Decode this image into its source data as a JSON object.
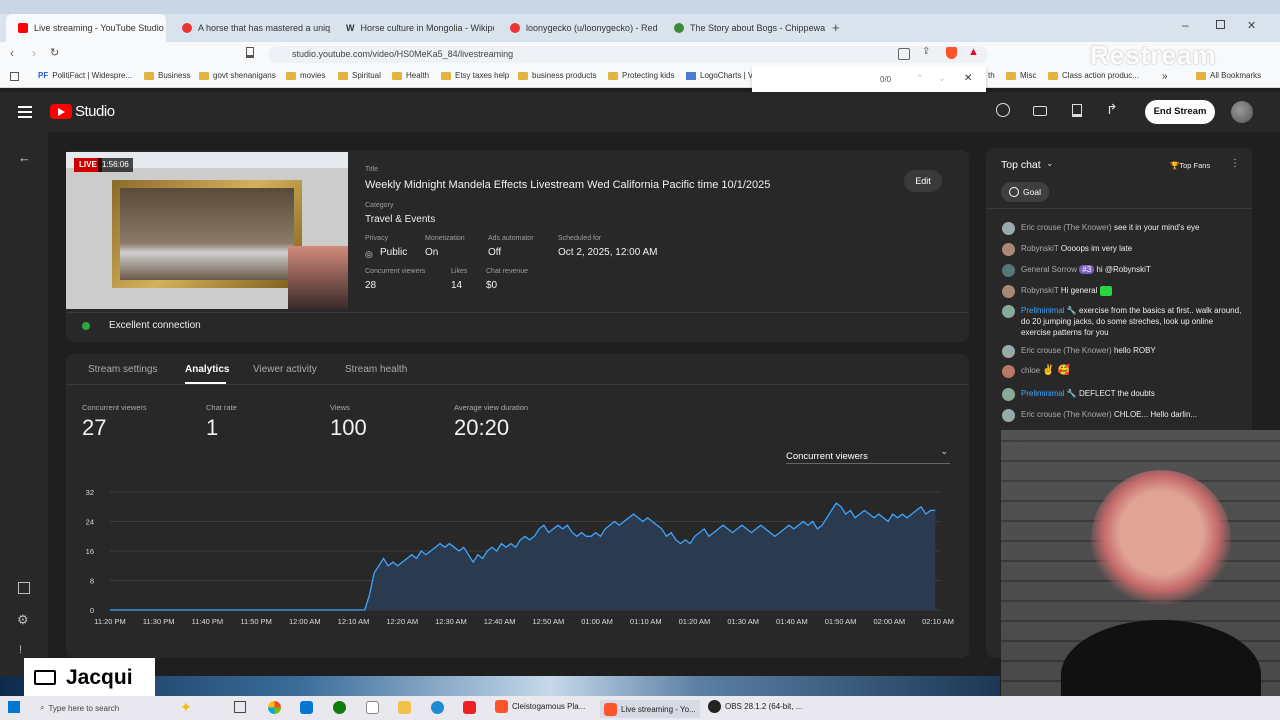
{
  "browser": {
    "tabs": [
      {
        "label": "Live streaming - YouTube Studio",
        "active": true,
        "icon": "youtube-icon"
      },
      {
        "label": "A horse that has mastered a unique",
        "icon": "reddit-icon"
      },
      {
        "label": "Horse culture in Mongolia - Wikiped",
        "icon": "wikipedia-icon"
      },
      {
        "label": "loonygecko (u/loonygecko) - Reddit",
        "icon": "reddit-icon"
      },
      {
        "label": "The Story about Bogs - Chippewa Fl",
        "icon": "leaf-icon"
      }
    ],
    "url": "studio.youtube.com/video/HS0MeKa5_84/livestreaming",
    "bookmarks": [
      "PolitiFact | Widespre...",
      "Business",
      "govt shenanigans",
      "movies",
      "Spiritual",
      "Health",
      "Etsy taxes help",
      "business products",
      "Protecting kids",
      "LogoCharts | V",
      "th",
      "Misc",
      "Class action produc...",
      "All Bookmarks"
    ],
    "find": {
      "count": "0/0"
    },
    "watermark": "Restream"
  },
  "studio": {
    "logo": "Studio",
    "end_stream": "End Stream"
  },
  "stream": {
    "live_badge": "LIVE",
    "live_time": "1:56:06",
    "title_label": "Title",
    "title": "Weekly Midnight Mandela Effects Livestream Wed California Pacific time 10/1/2025",
    "edit": "Edit",
    "category_label": "Category",
    "category": "Travel & Events",
    "privacy_label": "Privacy",
    "privacy": "Public",
    "monetization_label": "Monetization",
    "monetization": "On",
    "ads_label": "Ads automator",
    "ads": "Off",
    "scheduled_label": "Scheduled for",
    "scheduled": "Oct 2, 2025, 12:00 AM",
    "cv_label": "Concurrent viewers",
    "cv": "28",
    "likes_label": "Likes",
    "likes": "14",
    "revenue_label": "Chat revenue",
    "revenue": "$0",
    "connection": "Excellent connection"
  },
  "tabs": [
    "Stream settings",
    "Analytics",
    "Viewer activity",
    "Stream health"
  ],
  "metrics": [
    {
      "label": "Concurrent viewers",
      "value": "27"
    },
    {
      "label": "Chat rate",
      "value": "1"
    },
    {
      "label": "Views",
      "value": "100"
    },
    {
      "label": "Average view duration",
      "value": "20:20"
    }
  ],
  "chart_selector": "Concurrent viewers",
  "chart_data": {
    "type": "area",
    "x_ticks": [
      "11:20 PM",
      "11:30 PM",
      "11:40 PM",
      "11:50 PM",
      "12:00 AM",
      "12:10 AM",
      "12:20 AM",
      "12:30 AM",
      "12:40 AM",
      "12:50 AM",
      "01:00 AM",
      "01:10 AM",
      "01:20 AM",
      "01:30 AM",
      "01:40 AM",
      "01:50 AM",
      "02:00 AM",
      "02:10 AM"
    ],
    "y_ticks": [
      0,
      8,
      16,
      24,
      32
    ],
    "ylim": [
      0,
      32
    ],
    "xlim": [
      -40,
      136
    ],
    "x_unit": "minutes after 12:00 AM",
    "points": [
      [
        -40,
        0
      ],
      [
        -35,
        0
      ],
      [
        -30,
        0
      ],
      [
        -20,
        0
      ],
      [
        -10,
        0
      ],
      [
        0,
        0
      ],
      [
        10,
        0
      ],
      [
        14,
        0
      ],
      [
        15,
        4
      ],
      [
        16,
        10
      ],
      [
        17,
        12
      ],
      [
        18,
        14
      ],
      [
        19,
        12
      ],
      [
        20,
        13
      ],
      [
        21,
        12
      ],
      [
        22,
        13
      ],
      [
        23,
        14
      ],
      [
        24,
        15
      ],
      [
        25,
        14
      ],
      [
        26,
        16
      ],
      [
        27,
        15
      ],
      [
        28,
        16
      ],
      [
        29,
        17
      ],
      [
        30,
        18
      ],
      [
        31,
        17
      ],
      [
        32,
        18
      ],
      [
        33,
        17
      ],
      [
        34,
        16
      ],
      [
        35,
        17
      ],
      [
        36,
        15
      ],
      [
        37,
        13
      ],
      [
        38,
        15
      ],
      [
        39,
        14
      ],
      [
        40,
        16
      ],
      [
        41,
        17
      ],
      [
        42,
        16
      ],
      [
        43,
        18
      ],
      [
        44,
        17
      ],
      [
        45,
        18
      ],
      [
        46,
        17
      ],
      [
        47,
        19
      ],
      [
        48,
        20
      ],
      [
        49,
        19
      ],
      [
        50,
        20
      ],
      [
        51,
        22
      ],
      [
        52,
        23
      ],
      [
        53,
        21
      ],
      [
        54,
        22
      ],
      [
        55,
        23
      ],
      [
        56,
        22
      ],
      [
        57,
        23
      ],
      [
        58,
        21
      ],
      [
        59,
        20
      ],
      [
        60,
        21
      ],
      [
        61,
        20
      ],
      [
        62,
        20
      ],
      [
        63,
        21
      ],
      [
        64,
        20
      ],
      [
        65,
        22
      ],
      [
        66,
        23
      ],
      [
        67,
        24
      ],
      [
        68,
        23
      ],
      [
        69,
        24
      ],
      [
        70,
        25
      ],
      [
        71,
        26
      ],
      [
        72,
        25
      ],
      [
        73,
        24
      ],
      [
        74,
        25
      ],
      [
        75,
        24
      ],
      [
        76,
        23
      ],
      [
        77,
        22
      ],
      [
        78,
        20
      ],
      [
        79,
        21
      ],
      [
        80,
        19
      ],
      [
        81,
        18
      ],
      [
        82,
        19
      ],
      [
        83,
        18
      ],
      [
        84,
        20
      ],
      [
        85,
        21
      ],
      [
        86,
        22
      ],
      [
        87,
        20
      ],
      [
        88,
        21
      ],
      [
        89,
        22
      ],
      [
        90,
        23
      ],
      [
        91,
        22
      ],
      [
        92,
        21
      ],
      [
        93,
        22
      ],
      [
        94,
        23
      ],
      [
        95,
        22
      ],
      [
        96,
        21
      ],
      [
        97,
        22
      ],
      [
        98,
        23
      ],
      [
        99,
        22
      ],
      [
        100,
        21
      ],
      [
        101,
        20
      ],
      [
        102,
        21
      ],
      [
        103,
        22
      ],
      [
        104,
        23
      ],
      [
        105,
        22
      ],
      [
        106,
        23
      ],
      [
        107,
        24
      ],
      [
        108,
        23
      ],
      [
        109,
        24
      ],
      [
        110,
        22
      ],
      [
        111,
        23
      ],
      [
        112,
        25
      ],
      [
        113,
        27
      ],
      [
        114,
        29
      ],
      [
        115,
        28
      ],
      [
        116,
        26
      ],
      [
        117,
        27
      ],
      [
        118,
        25
      ],
      [
        119,
        26
      ],
      [
        120,
        27
      ],
      [
        121,
        26
      ],
      [
        122,
        25
      ],
      [
        123,
        26
      ],
      [
        124,
        25
      ],
      [
        125,
        24
      ],
      [
        126,
        26
      ],
      [
        127,
        25
      ],
      [
        128,
        26
      ],
      [
        129,
        25
      ],
      [
        130,
        26
      ],
      [
        131,
        27
      ],
      [
        132,
        28
      ],
      [
        133,
        26
      ],
      [
        134,
        27
      ],
      [
        135,
        27
      ]
    ],
    "colors": {
      "line": "#3ea6ff",
      "fill": "#2b3a4e"
    }
  },
  "chat": {
    "header": "Top chat",
    "top_fans": "Top Fans",
    "goal": "Goal",
    "messages": [
      {
        "author": "Eric crouse (The Knower)",
        "text": "see it in your mind's eye",
        "blue": false
      },
      {
        "author": "RobynskiT",
        "text": "Oooops im very late",
        "blue": false
      },
      {
        "author": "General Sorrow",
        "badge": "#3",
        "text": "hi @RobynskiT",
        "blue": false
      },
      {
        "author": "RobynskiT",
        "text": "Hi general",
        "blue": false
      },
      {
        "author": "Preliminimal",
        "text": "exercise from the basics at first.. walk around, do 20 jumping jacks, do some streches, look up online exercise patterns for you",
        "blue": true
      },
      {
        "author": "Eric crouse (The Knower)",
        "text": "hello ROBY",
        "blue": false
      },
      {
        "author": "chloe",
        "text": "✌ 🥰",
        "blue": false
      },
      {
        "author": "Preliminimal",
        "text": "DEFLECT the doubts",
        "blue": true
      },
      {
        "author": "Eric crouse (The Knower)",
        "text": "CHLOE... Hello darlin...",
        "blue": false
      }
    ]
  },
  "overlay": {
    "name": "Jacqui"
  },
  "taskbar": {
    "search": "Type here to search",
    "items": [
      "Cleistogamous Pla...",
      "Live streaming - Yo...",
      "OBS 28.1.2 (64-bit, ..."
    ]
  }
}
